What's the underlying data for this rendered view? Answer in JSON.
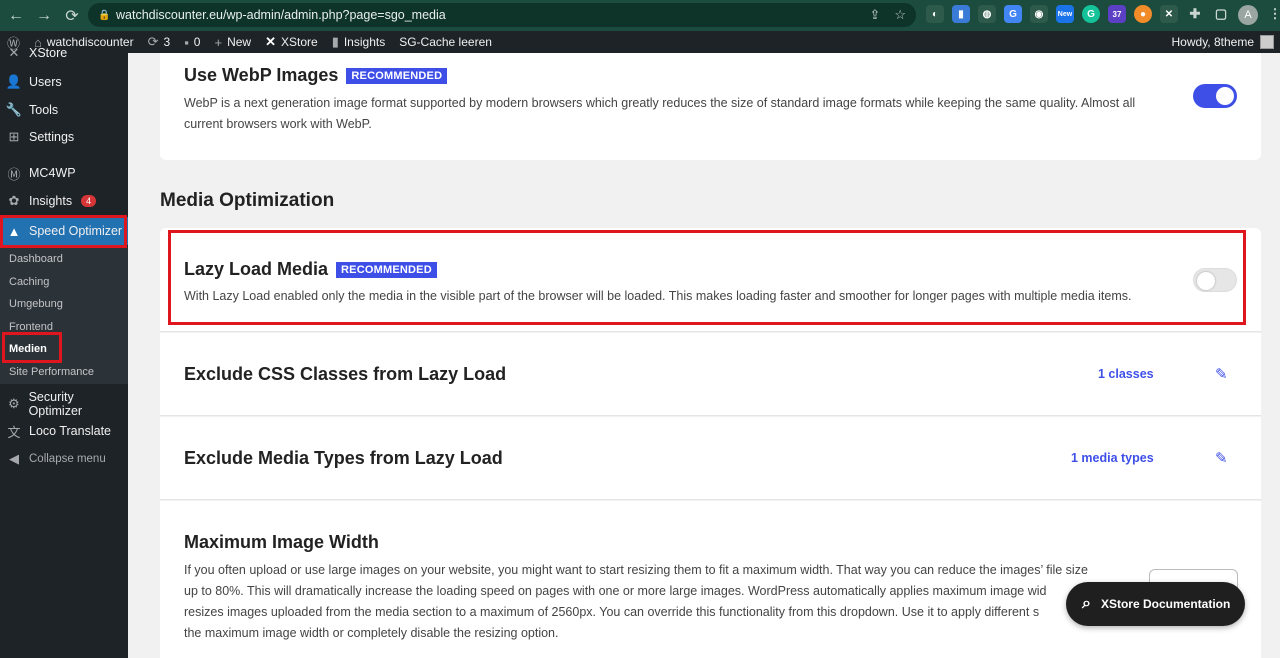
{
  "browser": {
    "url": "watchdiscounter.eu/wp-admin/admin.php?page=sgo_media",
    "profile_initial": "A",
    "ext_badge_new": "New",
    "ext_badge_37": "37"
  },
  "adminbar": {
    "site": "watchdiscounter",
    "updates": "3",
    "comments": "0",
    "new": "New",
    "xstore": "XStore",
    "insights": "Insights",
    "cache": "SG-Cache leeren",
    "howdy": "Howdy, 8theme"
  },
  "sidebar": {
    "xstore_partial": "XStore",
    "users": "Users",
    "tools": "Tools",
    "settings": "Settings",
    "mc4wp": "MC4WP",
    "insights": "Insights",
    "insights_count": "4",
    "speed_optimizer": "Speed Optimizer",
    "sub": [
      "Dashboard",
      "Caching",
      "Umgebung",
      "Frontend",
      "Medien",
      "Site Performance"
    ],
    "security": "Security Optimizer",
    "loco": "Loco Translate",
    "collapse": "Collapse menu"
  },
  "webp": {
    "title": "Use WebP Images",
    "badge": "RECOMMENDED",
    "desc": "WebP is a next generation image format supported by modern browsers which greatly reduces the size of standard image formats while keeping the same quality. Almost all current browsers work with WebP.",
    "enabled": true
  },
  "section_title": "Media Optimization",
  "lazy": {
    "title": "Lazy Load Media",
    "badge": "RECOMMENDED",
    "desc": "With Lazy Load enabled only the media in the visible part of the browser will be loaded. This makes loading faster and smoother for longer pages with multiple media items.",
    "enabled": false
  },
  "exclude_css": {
    "title": "Exclude CSS Classes from Lazy Load",
    "value": "1 classes"
  },
  "exclude_media": {
    "title": "Exclude Media Types from Lazy Load",
    "value": "1 media types"
  },
  "max_width": {
    "title": "Maximum Image Width",
    "desc_lines": [
      "If you often upload or use large images on your website, you might want to start resizing them to fit a maximum width. That way you can reduce the images’ file size",
      "up to 80%. This will dramatically increase the loading speed on pages with one or more large images. WordPress automatically applies maximum image wid",
      "resizes images uploaded from the media section to a maximum of 2560px. You can override this functionality from this dropdown. Use it to apply different s",
      "the maximum image width or completely disable the resizing option."
    ]
  },
  "doc_button": "XStore Documentation",
  "colors": {
    "accent": "#3e4fe8",
    "highlight": "#e0161e",
    "sidebar": "#1d2327",
    "active": "#2271b1"
  }
}
